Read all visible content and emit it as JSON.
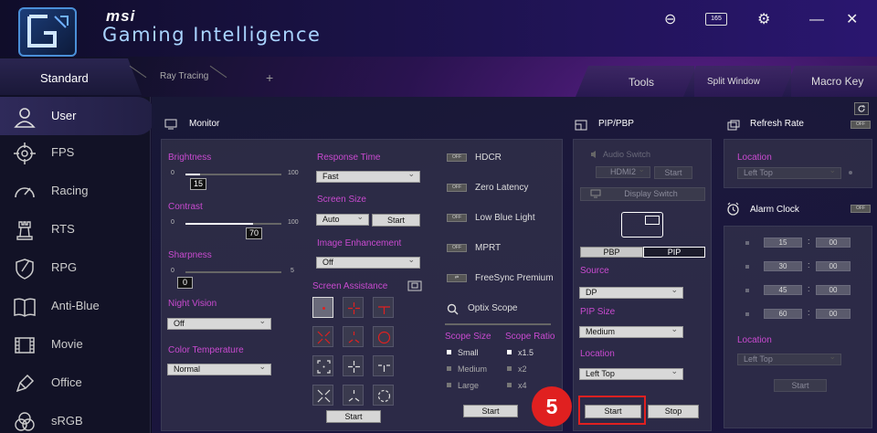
{
  "app": {
    "brand": "msi",
    "name": "Gaming Intelligence",
    "refresh_badge": "165"
  },
  "tabs": {
    "standard": "Standard",
    "ray_tracing": "Ray Tracing",
    "add": "+",
    "tools": "Tools",
    "split_window": "Split Window",
    "macro_key": "Macro Key"
  },
  "sidebar": {
    "items": [
      {
        "label": "User"
      },
      {
        "label": "FPS"
      },
      {
        "label": "Racing"
      },
      {
        "label": "RTS"
      },
      {
        "label": "RPG"
      },
      {
        "label": "Anti-Blue"
      },
      {
        "label": "Movie"
      },
      {
        "label": "Office"
      },
      {
        "label": "sRGB"
      }
    ]
  },
  "monitor": {
    "title": "Monitor",
    "brightness": {
      "label": "Brightness",
      "min": "0",
      "max": "100",
      "value": "15",
      "level": 0.15
    },
    "contrast": {
      "label": "Contrast",
      "min": "0",
      "max": "100",
      "value": "70",
      "level": 0.7
    },
    "sharpness": {
      "label": "Sharpness",
      "min": "0",
      "max": "5",
      "value": "0",
      "level": 0.0
    },
    "night_vision": {
      "label": "Night Vision",
      "value": "Off"
    },
    "color_temperature": {
      "label": "Color Temperature",
      "value": "Normal"
    },
    "response_time": {
      "label": "Response Time",
      "value": "Fast"
    },
    "screen_size": {
      "label": "Screen Size",
      "value": "Auto",
      "start": "Start"
    },
    "image_enhancement": {
      "label": "Image Enhancement",
      "value": "Off"
    },
    "screen_assistance": {
      "label": "Screen Assistance",
      "start": "Start"
    },
    "toggles": [
      {
        "state": "OFF",
        "label": "HDCR"
      },
      {
        "state": "OFF",
        "label": "Zero Latency"
      },
      {
        "state": "OFF",
        "label": "Low Blue Light"
      },
      {
        "state": "OFF",
        "label": "MPRT"
      },
      {
        "state": "",
        "label": "FreeSync Premium"
      }
    ],
    "optix": {
      "title": "Optix Scope",
      "size_title": "Scope Size",
      "ratio_title": "Scope Ratio",
      "sizes": [
        "Small",
        "Medium",
        "Large"
      ],
      "ratios": [
        "x1.5",
        "x2",
        "x4"
      ],
      "start": "Start"
    }
  },
  "pip": {
    "title": "PIP/PBP",
    "audio_switch": "Audio Switch",
    "audio_source": "HDMI2",
    "audio_start": "Start",
    "display_switch": "Display Switch",
    "mode_pbp": "PBP",
    "mode_pip": "PIP",
    "source_label": "Source",
    "source_value": "DP",
    "size_label": "PIP Size",
    "size_value": "Medium",
    "location_label": "Location",
    "location_value": "Left Top",
    "start": "Start",
    "stop": "Stop"
  },
  "refresh": {
    "title": "Refresh Rate",
    "toggle": "OFF",
    "location_label": "Location",
    "location_value": "Left Top"
  },
  "alarm": {
    "title": "Alarm Clock",
    "toggle": "OFF",
    "rows": [
      {
        "min": "15",
        "sec": "00"
      },
      {
        "min": "30",
        "sec": "00"
      },
      {
        "min": "45",
        "sec": "00"
      },
      {
        "min": "60",
        "sec": "00"
      }
    ],
    "location_label": "Location",
    "location_value": "Left Top",
    "start": "Start"
  },
  "callout": {
    "number": "5"
  },
  "colors": {
    "accent": "#c94ad0",
    "callout": "#e02020",
    "panel": "#3c3c50"
  }
}
